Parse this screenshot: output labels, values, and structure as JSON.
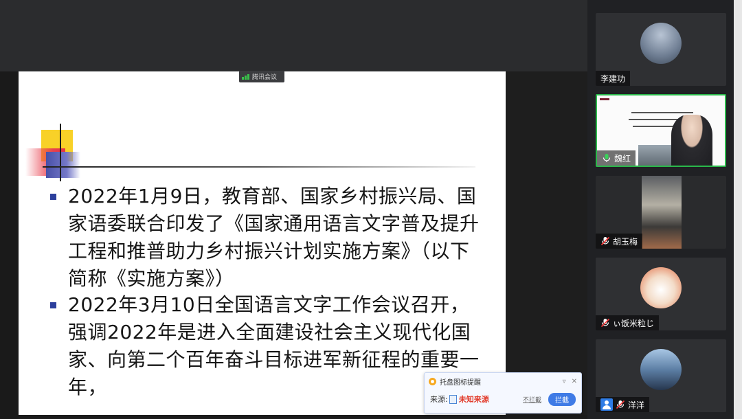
{
  "meeting": {
    "badge_label": "腾讯会议"
  },
  "slide": {
    "bullets": [
      {
        "text": "2022年1月9日，教育部、国家乡村振兴局、国家语委联合印发了《国家通用语言文字普及提升工程和推普助力乡村振兴计划实施方案》（以下简称《实施方案》）"
      },
      {
        "text": "2022年3月10日全国语言文字工作会议召开，强调2022年是进入全面建设社会主义现代化国家、向第二个百年奋斗目标进军新征程的重要一年，"
      }
    ],
    "accent_colors": {
      "yellow": "#f8d128",
      "red": "#e8404e",
      "blue": "#4850a8",
      "bullet": "#2c3f9c"
    }
  },
  "popup": {
    "title": "托盘图标提醒",
    "source_label": "来源:",
    "source_value": "未知来源",
    "no_block_label": "不拦截",
    "block_label": "拦截",
    "menu_glyph": "▿",
    "close_glyph": "✕"
  },
  "participants": [
    {
      "name": "李建功",
      "mic": "none"
    },
    {
      "name": "魏红",
      "mic": "on"
    },
    {
      "name": "胡玉梅",
      "mic": "muted"
    },
    {
      "name": "ぃ饭米粒じ",
      "mic": "muted"
    },
    {
      "name": "洋洋",
      "mic": "muted"
    }
  ]
}
